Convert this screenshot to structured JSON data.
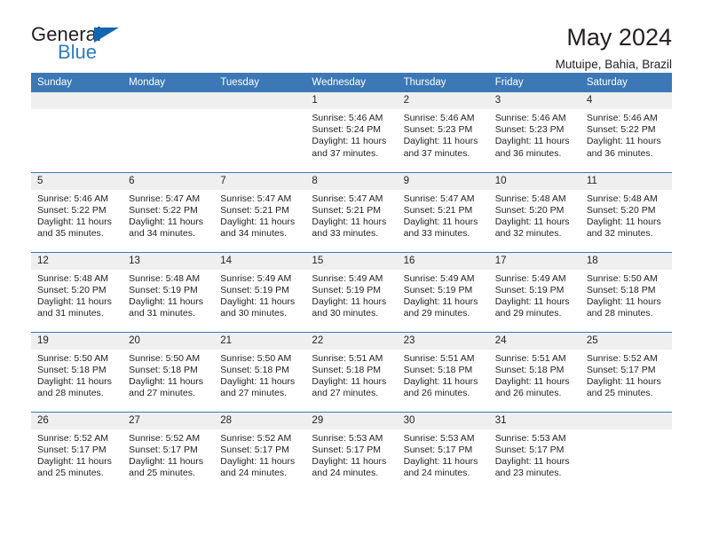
{
  "brand": {
    "name_top": "General",
    "name_bottom": "Blue",
    "triangle_icon": "triangle-icon",
    "color_dark": "#231f20",
    "color_blue": "#2e7cc4",
    "color_triangle": "#1266b0"
  },
  "header": {
    "title": "May 2024",
    "subtitle": "Mutuipe, Bahia, Brazil"
  },
  "theme": {
    "header_bg": "#3b78b5",
    "header_text": "#ffffff",
    "daynum_bg": "#efefef",
    "grid_line": "#3b78b5",
    "body_text": "#231f20"
  },
  "weekday_headers": [
    "Sunday",
    "Monday",
    "Tuesday",
    "Wednesday",
    "Thursday",
    "Friday",
    "Saturday"
  ],
  "labels": {
    "sunrise_prefix": "Sunrise:",
    "sunset_prefix": "Sunset:",
    "daylight_prefix": "Daylight:"
  },
  "weeks": [
    [
      {
        "day": "",
        "empty": true
      },
      {
        "day": "",
        "empty": true
      },
      {
        "day": "",
        "empty": true
      },
      {
        "day": "1",
        "sunrise": "Sunrise: 5:46 AM",
        "sunset": "Sunset: 5:24 PM",
        "daylight_1": "Daylight: 11 hours",
        "daylight_2": "and 37 minutes."
      },
      {
        "day": "2",
        "sunrise": "Sunrise: 5:46 AM",
        "sunset": "Sunset: 5:23 PM",
        "daylight_1": "Daylight: 11 hours",
        "daylight_2": "and 37 minutes."
      },
      {
        "day": "3",
        "sunrise": "Sunrise: 5:46 AM",
        "sunset": "Sunset: 5:23 PM",
        "daylight_1": "Daylight: 11 hours",
        "daylight_2": "and 36 minutes."
      },
      {
        "day": "4",
        "sunrise": "Sunrise: 5:46 AM",
        "sunset": "Sunset: 5:22 PM",
        "daylight_1": "Daylight: 11 hours",
        "daylight_2": "and 36 minutes."
      }
    ],
    [
      {
        "day": "5",
        "sunrise": "Sunrise: 5:46 AM",
        "sunset": "Sunset: 5:22 PM",
        "daylight_1": "Daylight: 11 hours",
        "daylight_2": "and 35 minutes."
      },
      {
        "day": "6",
        "sunrise": "Sunrise: 5:47 AM",
        "sunset": "Sunset: 5:22 PM",
        "daylight_1": "Daylight: 11 hours",
        "daylight_2": "and 34 minutes."
      },
      {
        "day": "7",
        "sunrise": "Sunrise: 5:47 AM",
        "sunset": "Sunset: 5:21 PM",
        "daylight_1": "Daylight: 11 hours",
        "daylight_2": "and 34 minutes."
      },
      {
        "day": "8",
        "sunrise": "Sunrise: 5:47 AM",
        "sunset": "Sunset: 5:21 PM",
        "daylight_1": "Daylight: 11 hours",
        "daylight_2": "and 33 minutes."
      },
      {
        "day": "9",
        "sunrise": "Sunrise: 5:47 AM",
        "sunset": "Sunset: 5:21 PM",
        "daylight_1": "Daylight: 11 hours",
        "daylight_2": "and 33 minutes."
      },
      {
        "day": "10",
        "sunrise": "Sunrise: 5:48 AM",
        "sunset": "Sunset: 5:20 PM",
        "daylight_1": "Daylight: 11 hours",
        "daylight_2": "and 32 minutes."
      },
      {
        "day": "11",
        "sunrise": "Sunrise: 5:48 AM",
        "sunset": "Sunset: 5:20 PM",
        "daylight_1": "Daylight: 11 hours",
        "daylight_2": "and 32 minutes."
      }
    ],
    [
      {
        "day": "12",
        "sunrise": "Sunrise: 5:48 AM",
        "sunset": "Sunset: 5:20 PM",
        "daylight_1": "Daylight: 11 hours",
        "daylight_2": "and 31 minutes."
      },
      {
        "day": "13",
        "sunrise": "Sunrise: 5:48 AM",
        "sunset": "Sunset: 5:19 PM",
        "daylight_1": "Daylight: 11 hours",
        "daylight_2": "and 31 minutes."
      },
      {
        "day": "14",
        "sunrise": "Sunrise: 5:49 AM",
        "sunset": "Sunset: 5:19 PM",
        "daylight_1": "Daylight: 11 hours",
        "daylight_2": "and 30 minutes."
      },
      {
        "day": "15",
        "sunrise": "Sunrise: 5:49 AM",
        "sunset": "Sunset: 5:19 PM",
        "daylight_1": "Daylight: 11 hours",
        "daylight_2": "and 30 minutes."
      },
      {
        "day": "16",
        "sunrise": "Sunrise: 5:49 AM",
        "sunset": "Sunset: 5:19 PM",
        "daylight_1": "Daylight: 11 hours",
        "daylight_2": "and 29 minutes."
      },
      {
        "day": "17",
        "sunrise": "Sunrise: 5:49 AM",
        "sunset": "Sunset: 5:19 PM",
        "daylight_1": "Daylight: 11 hours",
        "daylight_2": "and 29 minutes."
      },
      {
        "day": "18",
        "sunrise": "Sunrise: 5:50 AM",
        "sunset": "Sunset: 5:18 PM",
        "daylight_1": "Daylight: 11 hours",
        "daylight_2": "and 28 minutes."
      }
    ],
    [
      {
        "day": "19",
        "sunrise": "Sunrise: 5:50 AM",
        "sunset": "Sunset: 5:18 PM",
        "daylight_1": "Daylight: 11 hours",
        "daylight_2": "and 28 minutes."
      },
      {
        "day": "20",
        "sunrise": "Sunrise: 5:50 AM",
        "sunset": "Sunset: 5:18 PM",
        "daylight_1": "Daylight: 11 hours",
        "daylight_2": "and 27 minutes."
      },
      {
        "day": "21",
        "sunrise": "Sunrise: 5:50 AM",
        "sunset": "Sunset: 5:18 PM",
        "daylight_1": "Daylight: 11 hours",
        "daylight_2": "and 27 minutes."
      },
      {
        "day": "22",
        "sunrise": "Sunrise: 5:51 AM",
        "sunset": "Sunset: 5:18 PM",
        "daylight_1": "Daylight: 11 hours",
        "daylight_2": "and 27 minutes."
      },
      {
        "day": "23",
        "sunrise": "Sunrise: 5:51 AM",
        "sunset": "Sunset: 5:18 PM",
        "daylight_1": "Daylight: 11 hours",
        "daylight_2": "and 26 minutes."
      },
      {
        "day": "24",
        "sunrise": "Sunrise: 5:51 AM",
        "sunset": "Sunset: 5:18 PM",
        "daylight_1": "Daylight: 11 hours",
        "daylight_2": "and 26 minutes."
      },
      {
        "day": "25",
        "sunrise": "Sunrise: 5:52 AM",
        "sunset": "Sunset: 5:17 PM",
        "daylight_1": "Daylight: 11 hours",
        "daylight_2": "and 25 minutes."
      }
    ],
    [
      {
        "day": "26",
        "sunrise": "Sunrise: 5:52 AM",
        "sunset": "Sunset: 5:17 PM",
        "daylight_1": "Daylight: 11 hours",
        "daylight_2": "and 25 minutes."
      },
      {
        "day": "27",
        "sunrise": "Sunrise: 5:52 AM",
        "sunset": "Sunset: 5:17 PM",
        "daylight_1": "Daylight: 11 hours",
        "daylight_2": "and 25 minutes."
      },
      {
        "day": "28",
        "sunrise": "Sunrise: 5:52 AM",
        "sunset": "Sunset: 5:17 PM",
        "daylight_1": "Daylight: 11 hours",
        "daylight_2": "and 24 minutes."
      },
      {
        "day": "29",
        "sunrise": "Sunrise: 5:53 AM",
        "sunset": "Sunset: 5:17 PM",
        "daylight_1": "Daylight: 11 hours",
        "daylight_2": "and 24 minutes."
      },
      {
        "day": "30",
        "sunrise": "Sunrise: 5:53 AM",
        "sunset": "Sunset: 5:17 PM",
        "daylight_1": "Daylight: 11 hours",
        "daylight_2": "and 24 minutes."
      },
      {
        "day": "31",
        "sunrise": "Sunrise: 5:53 AM",
        "sunset": "Sunset: 5:17 PM",
        "daylight_1": "Daylight: 11 hours",
        "daylight_2": "and 23 minutes."
      },
      {
        "day": "",
        "empty": true
      }
    ]
  ]
}
